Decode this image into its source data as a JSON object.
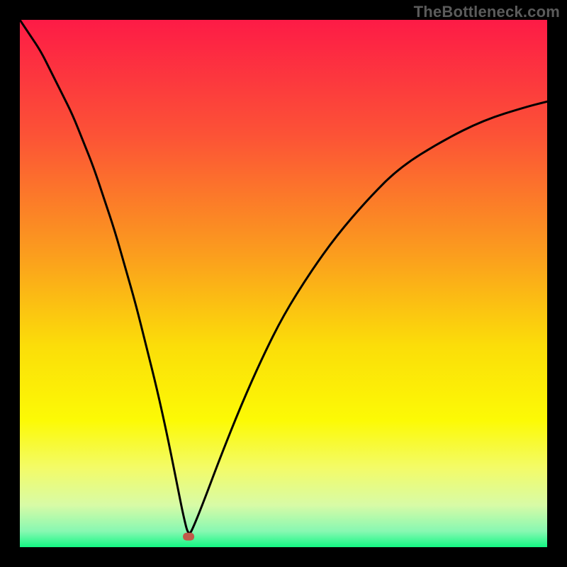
{
  "watermark": "TheBottleneck.com",
  "chart_data": {
    "type": "line",
    "title": "",
    "xlabel": "",
    "ylabel": "",
    "xlim": [
      0,
      100
    ],
    "ylim": [
      0,
      100
    ],
    "marker": {
      "x": 32,
      "y": 2,
      "color": "#c05a4a"
    },
    "gradient_stops": [
      {
        "offset": 0,
        "color": "#fd1b46"
      },
      {
        "offset": 22,
        "color": "#fc5336"
      },
      {
        "offset": 45,
        "color": "#fb9f1d"
      },
      {
        "offset": 62,
        "color": "#fbde09"
      },
      {
        "offset": 76,
        "color": "#fcfa05"
      },
      {
        "offset": 85,
        "color": "#f3fb68"
      },
      {
        "offset": 92,
        "color": "#d8fba6"
      },
      {
        "offset": 97,
        "color": "#87f8b2"
      },
      {
        "offset": 100,
        "color": "#13f783"
      }
    ],
    "series": [
      {
        "name": "bottleneck-curve",
        "x": [
          0,
          2,
          4,
          6,
          8,
          10,
          12,
          14,
          16,
          18,
          20,
          22,
          24,
          26,
          28,
          30,
          31,
          32,
          33,
          35,
          38,
          42,
          46,
          50,
          55,
          60,
          66,
          72,
          80,
          88,
          96,
          100
        ],
        "y": [
          100,
          97,
          94,
          90,
          86,
          82,
          77,
          72,
          66,
          60,
          53,
          46,
          38,
          30,
          21,
          11,
          6,
          2,
          4,
          9,
          17,
          27,
          36,
          44,
          52,
          59,
          66,
          72,
          77,
          81,
          83.5,
          84.5
        ]
      }
    ]
  }
}
